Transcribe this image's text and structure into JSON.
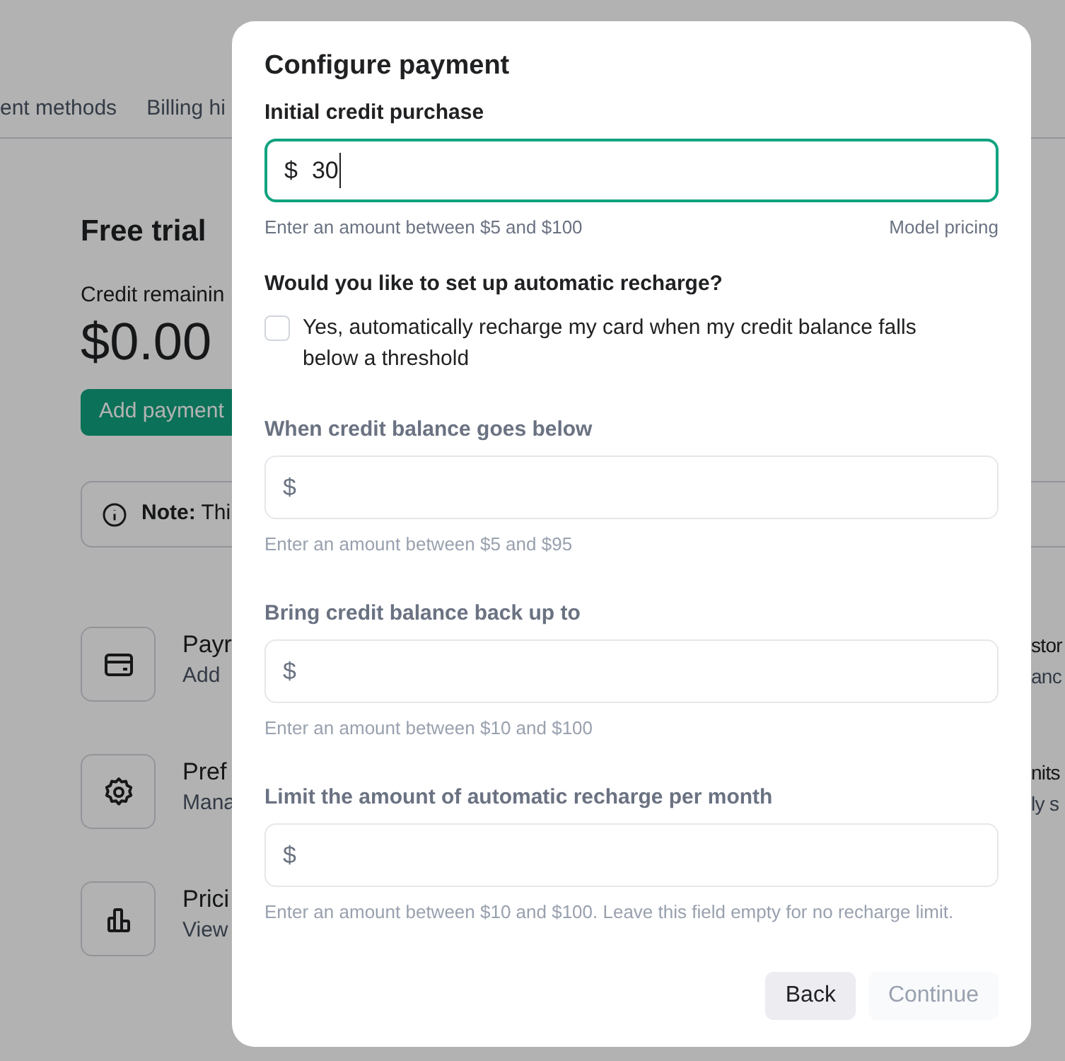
{
  "background_page": {
    "tabs": [
      {
        "label": "ent methods"
      },
      {
        "label": "Billing hi"
      }
    ],
    "title": "Free trial",
    "credit_label": "Credit remainin",
    "credit_amount": "$0.00",
    "add_button": "Add payment",
    "note": "**Note:** Thi",
    "cards": [
      {
        "kind": "card",
        "title": "Payr",
        "subtitle": "Add"
      },
      {
        "kind": "gear",
        "title": "Pref",
        "subtitle": "Mana"
      },
      {
        "kind": "chart",
        "title": "Prici",
        "subtitle": "View"
      }
    ],
    "right_cards": [
      {
        "title": "stor",
        "subtitle": "anc"
      },
      {
        "title": "nits",
        "subtitle": "ly s"
      }
    ]
  },
  "dialog": {
    "title": "Configure payment",
    "initial_purchase": {
      "label": "Initial credit purchase",
      "prefix": "$",
      "value": "30",
      "focused": true,
      "hint": "Enter an amount between $5 and $100",
      "link": "Model pricing"
    },
    "recharge_question": "Would you like to set up automatic recharge?",
    "recharge_checkbox": {
      "label": "Yes, automatically recharge my card when my credit balance falls below a threshold",
      "checked": false
    },
    "fields": [
      {
        "label": "When credit balance goes below",
        "prefix": "$",
        "hint": "Enter an amount between $5 and $95",
        "disabled": true
      },
      {
        "label": "Bring credit balance back up to",
        "prefix": "$",
        "hint": "Enter an amount between $10 and $100",
        "disabled": true
      },
      {
        "label": "Limit the amount of automatic recharge per month",
        "prefix": "$",
        "hint": "Enter an amount between $10 and $100. Leave this field empty for no recharge limit.",
        "disabled": true
      }
    ],
    "buttons": [
      {
        "label": "Back",
        "kind": "secondary",
        "disabled": false
      },
      {
        "label": "Continue",
        "kind": "primary",
        "disabled": true
      }
    ]
  }
}
